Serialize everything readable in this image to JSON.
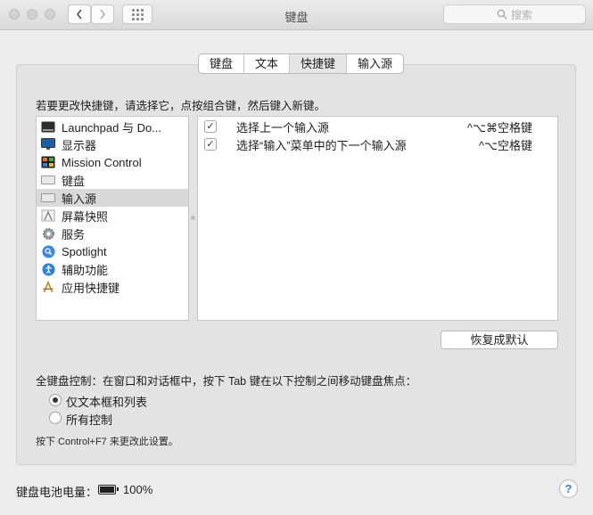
{
  "window": {
    "title": "键盘"
  },
  "search": {
    "placeholder": "搜索"
  },
  "tabs": [
    {
      "label": "键盘",
      "active": false
    },
    {
      "label": "文本",
      "active": false
    },
    {
      "label": "快捷键",
      "active": true
    },
    {
      "label": "输入源",
      "active": false
    }
  ],
  "instruction": "若要更改快捷键，请选择它，点按组合键，然后键入新键。",
  "categories": [
    {
      "label": "Launchpad 与 Do...",
      "icon": "launchpad-dock-icon",
      "selected": false
    },
    {
      "label": "显示器",
      "icon": "display-icon",
      "selected": false
    },
    {
      "label": "Mission Control",
      "icon": "mission-control-icon",
      "selected": false
    },
    {
      "label": "键盘",
      "icon": "keyboard-icon",
      "selected": false
    },
    {
      "label": "输入源",
      "icon": "input-source-icon",
      "selected": true
    },
    {
      "label": "屏幕快照",
      "icon": "screenshot-icon",
      "selected": false
    },
    {
      "label": "服务",
      "icon": "services-gear-icon",
      "selected": false
    },
    {
      "label": "Spotlight",
      "icon": "spotlight-icon",
      "selected": false
    },
    {
      "label": "辅助功能",
      "icon": "accessibility-icon",
      "selected": false
    },
    {
      "label": "应用快捷键",
      "icon": "app-shortcuts-icon",
      "selected": false
    }
  ],
  "shortcuts": [
    {
      "checked": true,
      "label": "选择上一个输入源",
      "keys": "^⌥⌘空格键"
    },
    {
      "checked": true,
      "label": "选择“输入”菜单中的下一个输入源",
      "keys": "^⌥空格键"
    }
  ],
  "restore_button": "恢复成默认",
  "full_keyboard_control": {
    "label": "全键盘控制：在窗口和对话框中，按下 Tab 键在以下控制之间移动键盘焦点：",
    "options": [
      {
        "label": "仅文本框和列表",
        "selected": true
      },
      {
        "label": "所有控制",
        "selected": false
      }
    ],
    "hint": "按下 Control+F7 来更改此设置。"
  },
  "battery": {
    "label": "键盘电池电量：",
    "percent": "100%"
  },
  "help": {
    "label": "?"
  }
}
